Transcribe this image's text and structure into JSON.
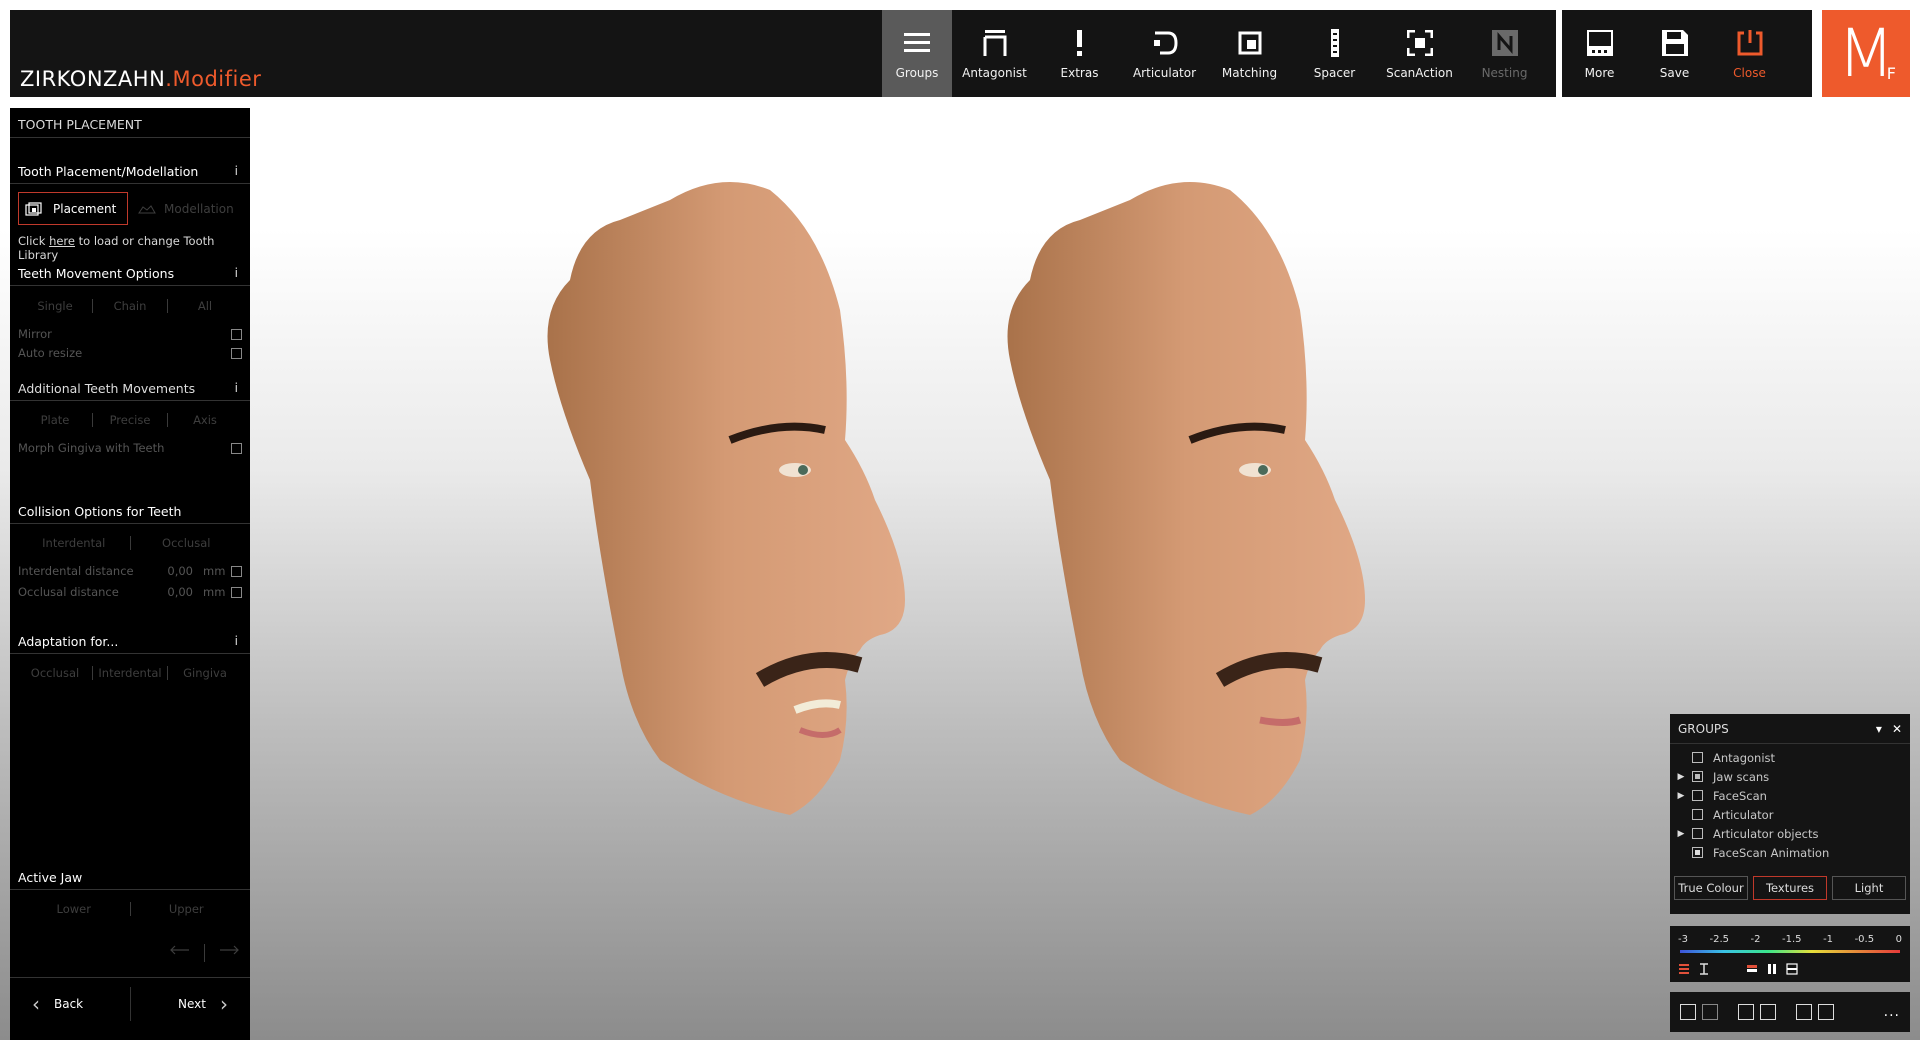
{
  "app": {
    "brand_main": "ZIRKONZAHN",
    "brand_accent": ".Modifier",
    "logo_letter": "M",
    "logo_sub": "F",
    "accent_color": "#ee5a2c"
  },
  "toolbar": [
    {
      "label": "Groups",
      "icon": "hamburger-icon",
      "state": "active"
    },
    {
      "label": "Antagonist",
      "icon": "antagonist-icon",
      "state": "normal"
    },
    {
      "label": "Extras",
      "icon": "exclamation-icon",
      "state": "normal"
    },
    {
      "label": "Articulator",
      "icon": "articulator-icon",
      "state": "normal"
    },
    {
      "label": "Matching",
      "icon": "matching-icon",
      "state": "normal"
    },
    {
      "label": "Spacer",
      "icon": "spacer-icon",
      "state": "normal"
    },
    {
      "label": "ScanAction",
      "icon": "scan-action-icon",
      "state": "normal"
    },
    {
      "label": "Nesting",
      "icon": "nesting-icon",
      "state": "disabled"
    }
  ],
  "toolbar_right": [
    {
      "label": "More",
      "icon": "more-icon"
    },
    {
      "label": "Save",
      "icon": "save-icon"
    },
    {
      "label": "Close",
      "icon": "power-icon"
    }
  ],
  "left_panel": {
    "title": "TOOTH PLACEMENT",
    "sections": {
      "placement_modellation": "Tooth Placement/Modellation",
      "placement_btn": "Placement",
      "modellation_btn": "Modellation",
      "hint_prefix": "Click ",
      "hint_link": "here",
      "hint_suffix": " to load or change Tooth Library",
      "teeth_movement": "Teeth Movement Options",
      "movement_modes": [
        "Single",
        "Chain",
        "All"
      ],
      "mirror": "Mirror",
      "auto_resize": "Auto resize",
      "additional": "Additional Teeth Movements",
      "additional_modes": [
        "Plate",
        "Precise",
        "Axis"
      ],
      "morph": "Morph Gingiva with Teeth",
      "collision": "Collision Options for Teeth",
      "collision_modes": [
        "Interdental",
        "Occlusal"
      ],
      "interdental_distance": "Interdental distance",
      "interdental_value": "0,00",
      "occlusal_distance": "Occlusal distance",
      "occlusal_value": "0,00",
      "unit": "mm",
      "adaptation": "Adaptation for...",
      "adaptation_modes": [
        "Occlusal",
        "Interdental",
        "Gingiva"
      ],
      "active_jaw": "Active Jaw",
      "jaw_modes": [
        "Lower",
        "Upper"
      ],
      "info": "i"
    },
    "nav": {
      "back": "Back",
      "next": "Next"
    }
  },
  "groups_panel": {
    "title": "GROUPS",
    "items": [
      {
        "label": "Antagonist",
        "expandable": false,
        "check": "empty"
      },
      {
        "label": "Jaw scans",
        "expandable": true,
        "check": "partial"
      },
      {
        "label": "FaceScan",
        "expandable": true,
        "check": "empty"
      },
      {
        "label": "Articulator",
        "expandable": false,
        "check": "empty"
      },
      {
        "label": "Articulator objects",
        "expandable": true,
        "check": "empty"
      },
      {
        "label": "FaceScan Animation",
        "expandable": false,
        "check": "checked"
      }
    ],
    "view_modes": [
      "True Colour",
      "Textures",
      "Light"
    ],
    "active_view_mode": "Textures"
  },
  "scale": {
    "labels": [
      "-3",
      "-2.5",
      "-2",
      "-1.5",
      "-1",
      "-0.5",
      "0"
    ]
  },
  "view_panel": {
    "more": "..."
  }
}
